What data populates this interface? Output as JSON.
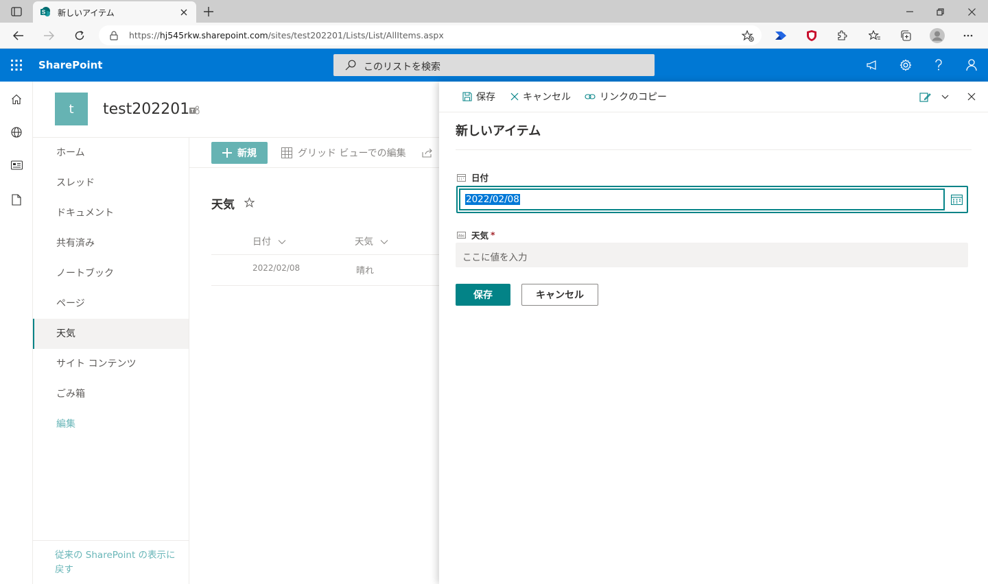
{
  "browser": {
    "tab_title": "新しいアイテム",
    "url_prefix": "https://",
    "url_host": "hj545rkw.sharepoint.com",
    "url_path": "/sites/test202201/Lists/List/AllItems.aspx"
  },
  "suite": {
    "brand": "SharePoint",
    "search_placeholder": "このリストを検索"
  },
  "site": {
    "logo_letter": "t",
    "title": "test202201"
  },
  "nav": {
    "items": [
      "ホーム",
      "スレッド",
      "ドキュメント",
      "共有済み",
      "ノートブック",
      "ページ",
      "天気",
      "サイト コンテンツ",
      "ごみ箱"
    ],
    "edit": "編集",
    "classic_link": "従来の SharePoint の表示に戻す"
  },
  "commands": {
    "new": "新規",
    "grid_edit": "グリッド ビューでの編集"
  },
  "list": {
    "title": "天気",
    "columns": [
      "日付",
      "天気"
    ],
    "rows": [
      {
        "date": "2022/02/08",
        "weather": "晴れ"
      }
    ]
  },
  "panel": {
    "toolbar": {
      "save": "保存",
      "cancel": "キャンセル",
      "copy_link": "リンクのコピー"
    },
    "title": "新しいアイテム",
    "date_label": "日付",
    "date_value": "2022/02/08",
    "weather_label": "天気",
    "required_mark": "*",
    "weather_placeholder": "ここに値を入力",
    "save_button": "保存",
    "cancel_button": "キャンセル"
  },
  "colors": {
    "suite": "#0078d4",
    "accent": "#038387",
    "site_theme": "#66b3b3"
  }
}
